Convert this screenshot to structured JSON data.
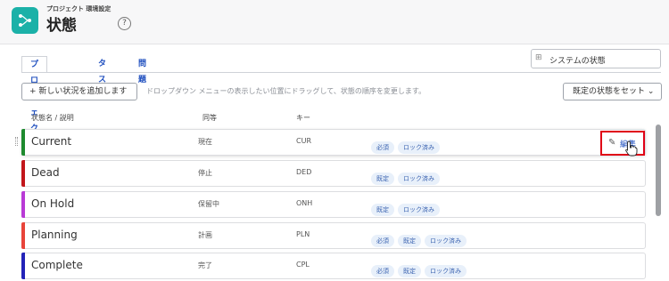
{
  "header": {
    "breadcrumb": "プロジェクト 環境設定",
    "title": "状態",
    "help_label": "?"
  },
  "tabs": [
    {
      "label": "プロジェクト",
      "active": true
    },
    {
      "label": "タスク",
      "active": false
    },
    {
      "label": "問題",
      "active": false
    }
  ],
  "search": {
    "icon": "filter-icon",
    "text": "システムの状態"
  },
  "toolbar": {
    "add_label": "+ 新しい状況を追加します",
    "hint": "ドロップダウン メニューの表示したい位置にドラッグして、状態の順序を変更します。",
    "default_label": "既定の状態をセット ⌄"
  },
  "columns": {
    "name": "状態名 / 説明",
    "equivalent": "同等",
    "key": "キー"
  },
  "rows": [
    {
      "name": "Current",
      "equivalent": "現在",
      "key": "CUR",
      "color": "#1e8a2e",
      "tags": [
        "必須",
        "ロック済み"
      ]
    },
    {
      "name": "Dead",
      "equivalent": "停止",
      "key": "DED",
      "color": "#c2161b",
      "tags": [
        "既定",
        "ロック済み"
      ]
    },
    {
      "name": "On Hold",
      "equivalent": "保留中",
      "key": "ONH",
      "color": "#b93ad6",
      "tags": [
        "既定",
        "ロック済み"
      ]
    },
    {
      "name": "Planning",
      "equivalent": "計画",
      "key": "PLN",
      "color": "#e8443a",
      "tags": [
        "必須",
        "既定",
        "ロック済み"
      ]
    },
    {
      "name": "Complete",
      "equivalent": "完了",
      "key": "CPL",
      "color": "#2323b8",
      "tags": [
        "必須",
        "既定",
        "ロック済み"
      ]
    }
  ],
  "edit": {
    "label": "編集",
    "icon": "pencil-icon",
    "highlight_color": "#e00016"
  }
}
